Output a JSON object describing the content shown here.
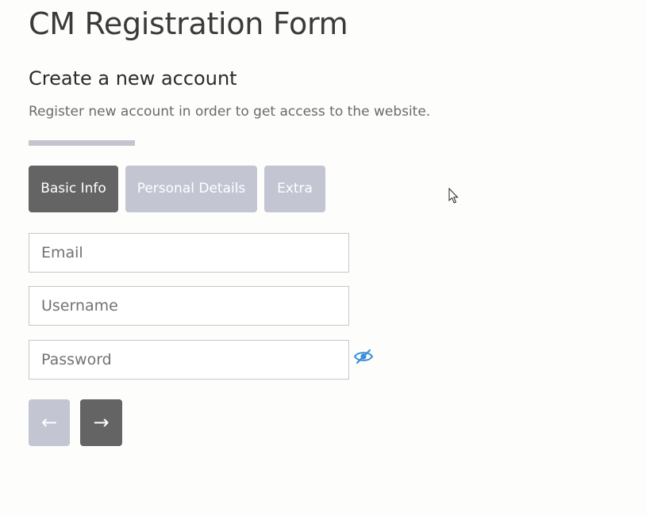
{
  "page": {
    "title": "CM Registration Form"
  },
  "form": {
    "heading": "Create a new account",
    "description": "Register new account in order to get access to the website.",
    "tabs": [
      {
        "label": "Basic Info",
        "active": true
      },
      {
        "label": "Personal Details",
        "active": false
      },
      {
        "label": "Extra",
        "active": false
      }
    ],
    "fields": {
      "email": {
        "placeholder": "Email",
        "value": ""
      },
      "username": {
        "placeholder": "Username",
        "value": ""
      },
      "password": {
        "placeholder": "Password",
        "value": ""
      }
    },
    "nav": {
      "prev_label": "←",
      "next_label": "→"
    }
  },
  "icons": {
    "password_toggle": "eye-slash-icon",
    "cursor": "mouse-pointer-icon"
  },
  "colors": {
    "active_tab": "#646464",
    "inactive_tab": "#c3c5d3",
    "eye_icon": "#3a8fd6"
  }
}
